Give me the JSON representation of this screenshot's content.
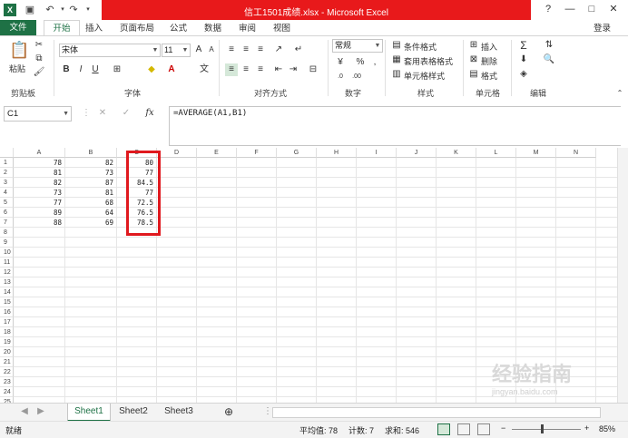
{
  "window": {
    "title": "信工1501成绩.xlsx -  Microsoft Excel",
    "controls": [
      "?",
      "—",
      "□",
      "✕"
    ]
  },
  "tabs": {
    "file": "文件",
    "items": [
      "开始",
      "插入",
      "页面布局",
      "公式",
      "数据",
      "审阅",
      "视图"
    ],
    "login": "登录"
  },
  "ribbon": {
    "clipboard": {
      "paste": "粘贴",
      "label": "剪贴板"
    },
    "font": {
      "name": "宋体",
      "size": "11",
      "label": "字体"
    },
    "alignment": {
      "label": "对齐方式"
    },
    "number": {
      "format": "常规",
      "label": "数字"
    },
    "styles": {
      "conditional": "条件格式",
      "table": "套用表格格式",
      "cell": "单元格样式",
      "label": "样式"
    },
    "cells": {
      "insert": "插入",
      "delete": "删除",
      "format": "格式",
      "label": "单元格"
    },
    "editing": {
      "label": "编辑"
    }
  },
  "formula_bar": {
    "name_box": "C1",
    "formula": "=AVERAGE(A1,B1)",
    "fx": "fx"
  },
  "grid": {
    "columns": [
      "A",
      "B",
      "C",
      "D",
      "E",
      "F",
      "G",
      "H",
      "I",
      "J",
      "K",
      "L",
      "M",
      "N"
    ],
    "rows": [
      "1",
      "2",
      "3",
      "4",
      "5",
      "6",
      "7",
      "8",
      "9",
      "10",
      "11",
      "12",
      "13",
      "14",
      "15",
      "16",
      "17",
      "18",
      "19",
      "20",
      "21",
      "22",
      "23",
      "24",
      "25"
    ],
    "data": [
      [
        "78",
        "82",
        "80"
      ],
      [
        "81",
        "73",
        "77"
      ],
      [
        "82",
        "87",
        "84.5"
      ],
      [
        "73",
        "81",
        "77"
      ],
      [
        "77",
        "68",
        "72.5"
      ],
      [
        "89",
        "64",
        "76.5"
      ],
      [
        "88",
        "69",
        "78.5"
      ]
    ]
  },
  "sheets": {
    "tabs": [
      "Sheet1",
      "Sheet2",
      "Sheet3"
    ],
    "active": "Sheet1"
  },
  "status": {
    "ready": "就绪",
    "average": "平均值: 78",
    "count": "计数: 7",
    "sum": "求和: 546",
    "zoom": "85%"
  },
  "watermark": {
    "text": "经验指南",
    "sub": "jingyan.baidu.com"
  },
  "colors": {
    "excel_green": "#1e7145",
    "title_red": "#e8191b",
    "highlight_red": "#e0191e"
  }
}
